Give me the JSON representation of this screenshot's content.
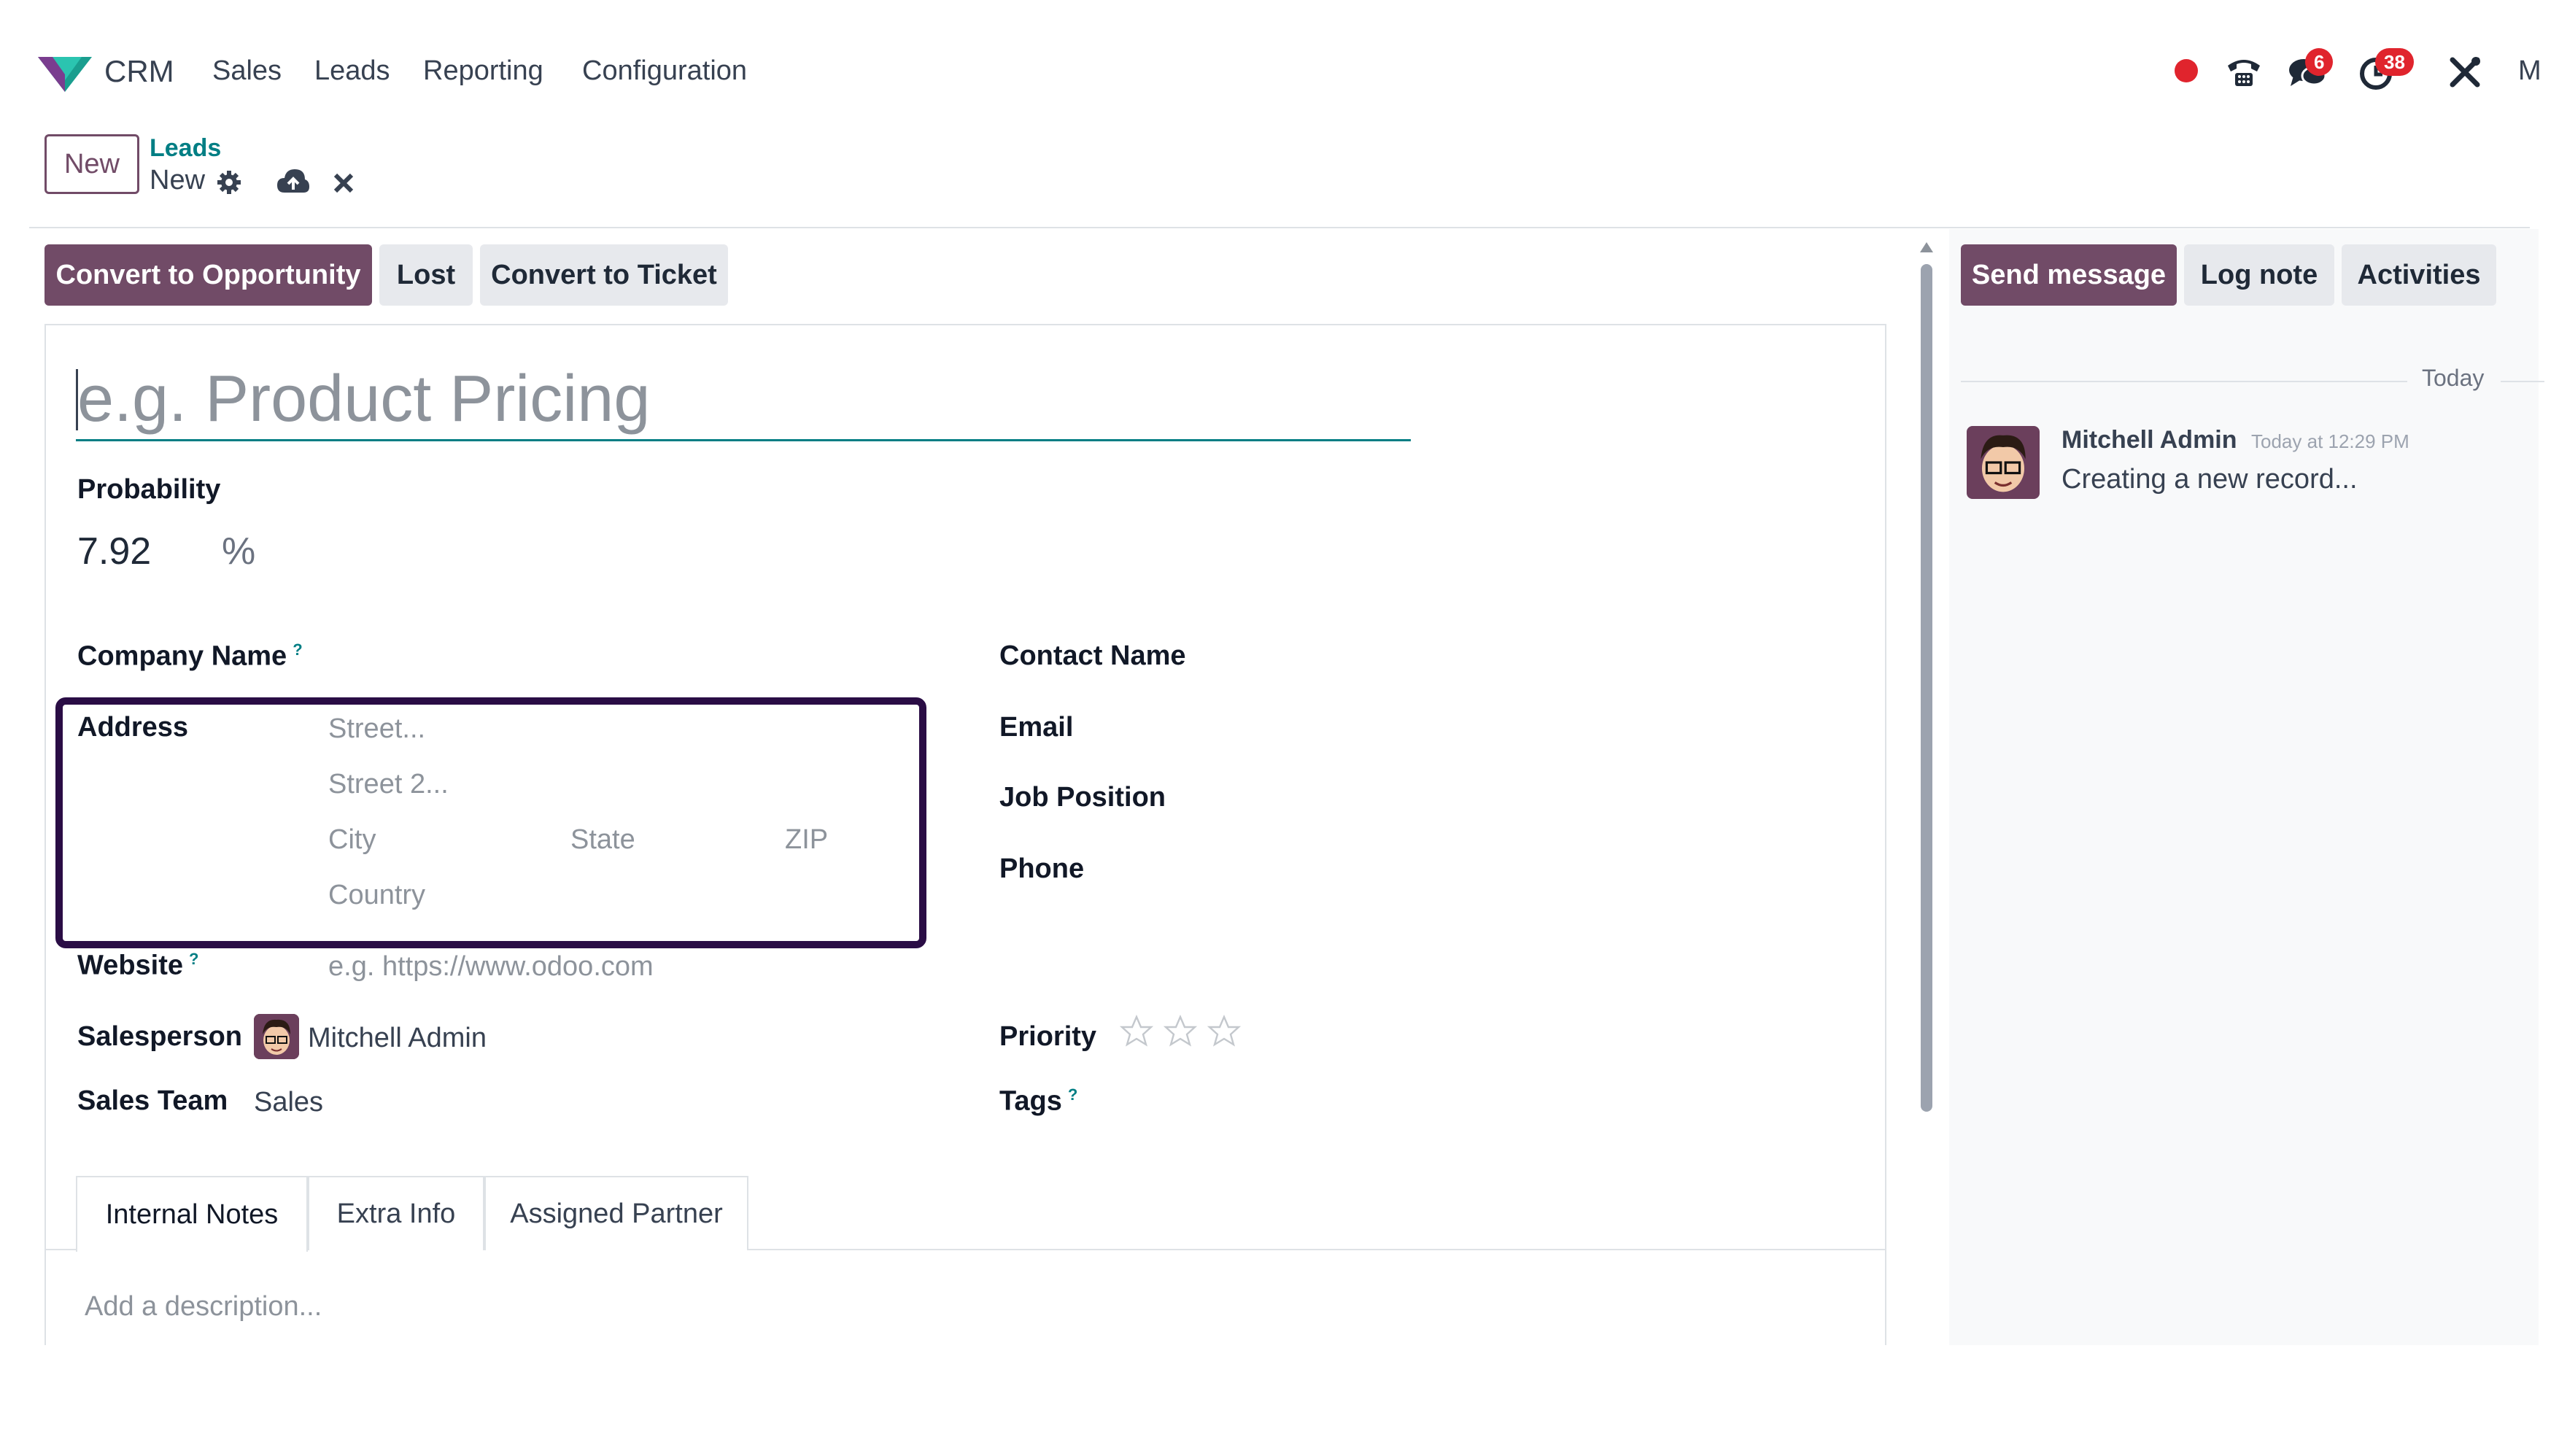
{
  "navbar": {
    "app_name": "CRM",
    "menu": [
      "Sales",
      "Leads",
      "Reporting",
      "Configuration"
    ],
    "messages_badge": "6",
    "activities_badge": "38",
    "user_initial": "M"
  },
  "control": {
    "new_button": "New",
    "breadcrumb_parent": "Leads",
    "breadcrumb_current": "New"
  },
  "statusbar": {
    "convert_opportunity": "Convert to Opportunity",
    "lost": "Lost",
    "convert_ticket": "Convert to Ticket"
  },
  "form": {
    "title_placeholder": "e.g. Product Pricing",
    "probability_label": "Probability",
    "probability_value": "7.92",
    "probability_unit": "%",
    "company_name_label": "Company Name",
    "tooltip_mark": "?",
    "address_label": "Address",
    "street_placeholder": "Street...",
    "street2_placeholder": "Street 2...",
    "city_placeholder": "City",
    "state_placeholder": "State",
    "zip_placeholder": "ZIP",
    "country_placeholder": "Country",
    "website_label": "Website",
    "website_placeholder": "e.g. https://www.odoo.com",
    "salesperson_label": "Salesperson",
    "salesperson_value": "Mitchell Admin",
    "sales_team_label": "Sales Team",
    "sales_team_value": "Sales",
    "contact_name_label": "Contact Name",
    "email_label": "Email",
    "job_position_label": "Job Position",
    "phone_label": "Phone",
    "priority_label": "Priority",
    "priority_stars": 0,
    "tags_label": "Tags",
    "tabs": [
      "Internal Notes",
      "Extra Info",
      "Assigned Partner"
    ],
    "description_placeholder": "Add a description..."
  },
  "chatter": {
    "send_message": "Send message",
    "log_note": "Log note",
    "activities": "Activities",
    "date_separator": "Today",
    "author": "Mitchell Admin",
    "timestamp": "Today at 12:29 PM",
    "message": "Creating a new record..."
  },
  "colors": {
    "brand": "#714b67",
    "highlight_box": "#2a0d45",
    "link": "#017e84",
    "badge": "#e0242d"
  },
  "icons": [
    "crm-logo-icon",
    "record-dot-icon",
    "phone-icon",
    "chat-icon",
    "clock-icon",
    "tools-icon",
    "gear-icon",
    "cloud-upload-icon",
    "close-icon",
    "star-icon"
  ]
}
